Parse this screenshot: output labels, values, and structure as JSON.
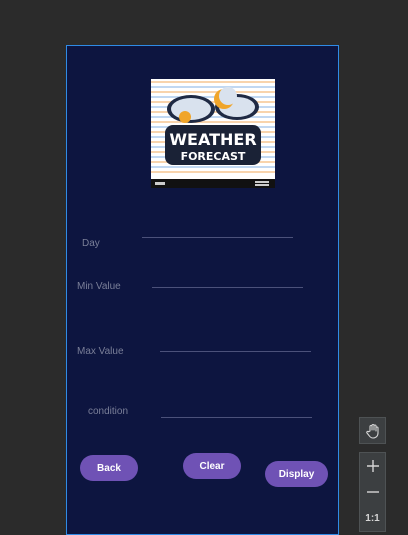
{
  "form": {
    "day_label": "Day",
    "min_label": "Min Value",
    "max_label": "Max Value",
    "condition_label": "condition"
  },
  "buttons": {
    "back": "Back",
    "clear": "Clear",
    "display": "Display"
  },
  "logo": {
    "line1": "WEATHER",
    "line2": "FORECAST"
  },
  "toolbar": {
    "zoom_reset_label": "1:1"
  },
  "colors": {
    "screen_bg": "#0d1540",
    "button": "#6f52b5",
    "selection_border": "#2f8be6",
    "label": "#7a7f98"
  },
  "icons": {
    "pan": "hand-icon",
    "zoom_in": "plus-icon",
    "zoom_out": "minus-icon"
  }
}
